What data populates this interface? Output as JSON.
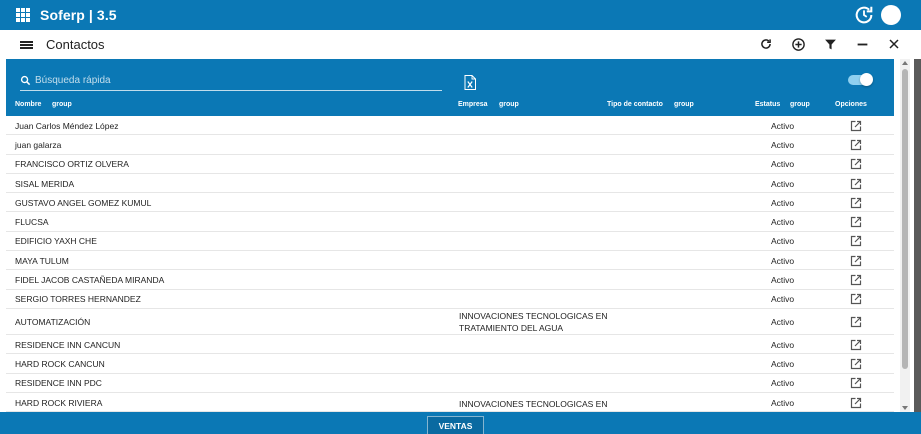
{
  "app": {
    "title": "Soferp | 3.5"
  },
  "dialog": {
    "title": "Contactos"
  },
  "filter": {
    "search_placeholder": "Búsqueda rápida"
  },
  "columns": {
    "nombre": "Nombre",
    "nombre_group": "group",
    "empresa": "Empresa",
    "empresa_group": "group",
    "tipo": "Tipo de contacto",
    "tipo_group": "group",
    "estatus": "Estatus",
    "estatus_group": "group",
    "opciones": "Opciones"
  },
  "rows": [
    {
      "name": "Juan Carlos Méndez López",
      "empresa": "",
      "estatus": "Activo"
    },
    {
      "name": "juan galarza",
      "empresa": "",
      "estatus": "Activo"
    },
    {
      "name": "FRANCISCO ORTIZ OLVERA",
      "empresa": "",
      "estatus": "Activo"
    },
    {
      "name": "SISAL MERIDA",
      "empresa": "",
      "estatus": "Activo"
    },
    {
      "name": "GUSTAVO ANGEL GOMEZ KUMUL",
      "empresa": "",
      "estatus": "Activo"
    },
    {
      "name": "FLUCSA",
      "empresa": "",
      "estatus": "Activo"
    },
    {
      "name": "EDIFICIO YAXH CHE",
      "empresa": "",
      "estatus": "Activo"
    },
    {
      "name": "MAYA TULUM",
      "empresa": "",
      "estatus": "Activo"
    },
    {
      "name": "FIDEL JACOB CASTAÑEDA MIRANDA",
      "empresa": "",
      "estatus": "Activo"
    },
    {
      "name": "SERGIO TORRES HERNANDEZ",
      "empresa": "",
      "estatus": "Activo"
    },
    {
      "name": "AUTOMATIZACIÓN",
      "empresa": "INNOVACIONES TECNOLOGICAS EN TRATAMIENTO DEL AGUA",
      "estatus": "Activo"
    },
    {
      "name": "RESIDENCE INN CANCUN",
      "empresa": "",
      "estatus": "Activo"
    },
    {
      "name": "HARD ROCK CANCUN",
      "empresa": "",
      "estatus": "Activo"
    },
    {
      "name": "RESIDENCE INN PDC",
      "empresa": "",
      "estatus": "Activo"
    },
    {
      "name": "HARD ROCK RIVIERA",
      "empresa": "INNOVACIONES TECNOLOGICAS EN",
      "estatus": "Activo"
    }
  ],
  "bottom": {
    "ventas_label": "VENTAS"
  },
  "icons": {
    "apps": "apps-grid-icon",
    "refresh_clock": "refresh-clock-icon",
    "menu": "hamburger-menu-icon",
    "refresh": "refresh-icon",
    "add": "add-circle-icon",
    "filter": "filter-icon",
    "minimize": "minimize-icon",
    "close": "close-icon",
    "search": "search-icon",
    "excel": "excel-export-icon",
    "open": "open-in-new-icon"
  },
  "colors": {
    "primary": "#0b78b5",
    "row_border": "#e6e6e6"
  }
}
